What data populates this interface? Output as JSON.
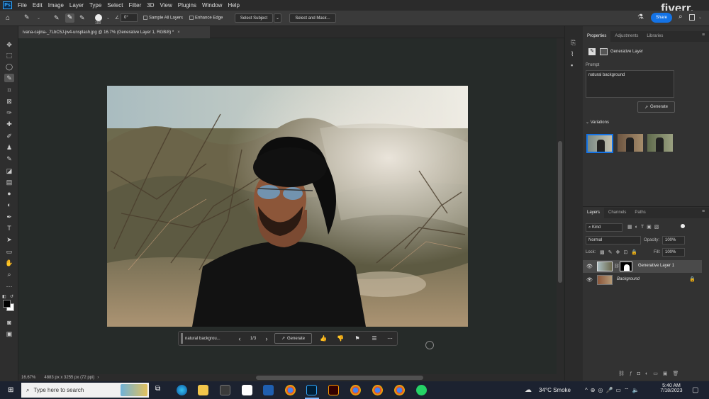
{
  "menubar": {
    "app_icon": "Ps",
    "items": [
      "File",
      "Edit",
      "Image",
      "Layer",
      "Type",
      "Select",
      "Filter",
      "3D",
      "View",
      "Plugins",
      "Window",
      "Help"
    ],
    "watermark": "fiverr."
  },
  "options": {
    "brush_size": "100",
    "angle": "0°",
    "sample_all_layers": "Sample All Layers",
    "enhance_edge": "Enhance Edge",
    "select_subject": "Select Subject",
    "select_mask": "Select and Mask...",
    "share": "Share"
  },
  "document": {
    "tab_title": "ivana-cajina-_7LbC5J-jw4-unsplash.jpg @ 16.7% (Generative Layer 1, RGB/8) *",
    "tab_close": "×"
  },
  "context_bar": {
    "prompt": "natural backgrou...",
    "counter": "1/3",
    "generate": "Generate"
  },
  "status": {
    "zoom": "16.67%",
    "doc_info": "4883 px x 3255 px (72 ppi)"
  },
  "properties": {
    "tabs": [
      "Properties",
      "Adjustments",
      "Libraries"
    ],
    "layer_type": "Generative Layer",
    "prompt_label": "Prompt",
    "prompt_value": "natural background",
    "generate": "Generate",
    "variations_label": "Variations"
  },
  "layers": {
    "tabs": [
      "Layers",
      "Channels",
      "Paths"
    ],
    "filter_kind": "Kind",
    "blend_mode": "Normal",
    "opacity_label": "Opacity:",
    "opacity_value": "100%",
    "lock_label": "Lock:",
    "fill_label": "Fill:",
    "fill_value": "100%",
    "items": [
      {
        "name": "Generative Layer 1"
      },
      {
        "name": "Background"
      }
    ]
  },
  "taskbar": {
    "search_placeholder": "Type here to search",
    "weather": "34°C  Smoke",
    "time": "5:40 AM",
    "date": "7/18/2023"
  },
  "colors": {
    "accent": "#1473e6",
    "canvas_bg": "#262b29",
    "panel_bg": "#323232"
  }
}
